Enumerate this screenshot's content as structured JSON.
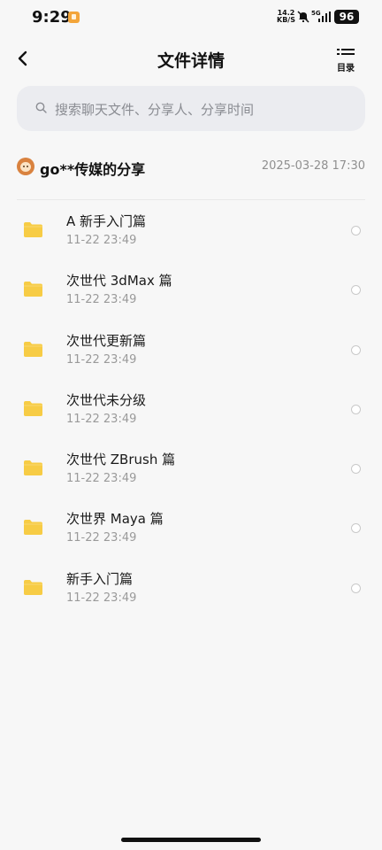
{
  "status_bar": {
    "time": "9:29",
    "net_speed_value": "14.2",
    "net_speed_unit": "KB/S",
    "network_type": "5G",
    "battery": "96"
  },
  "header": {
    "title": "文件详情",
    "toc_label": "目录"
  },
  "search": {
    "placeholder": "搜索聊天文件、分享人、分享时间"
  },
  "share": {
    "sharer": "go**传媒的分享",
    "time": "2025-03-28  17:30"
  },
  "files": [
    {
      "name": "A 新手入门篇",
      "date": "11-22  23:49"
    },
    {
      "name": "次世代 3dMax 篇",
      "date": "11-22  23:49"
    },
    {
      "name": "次世代更新篇",
      "date": "11-22  23:49"
    },
    {
      "name": "次世代未分级",
      "date": "11-22  23:49"
    },
    {
      "name": "次世代 ZBrush 篇",
      "date": "11-22  23:49"
    },
    {
      "name": "次世界 Maya 篇",
      "date": "11-22  23:49"
    },
    {
      "name": "新手入门篇",
      "date": "11-22  23:49"
    }
  ],
  "colors": {
    "folder": "#f7cc45",
    "search_bg": "#ebecf0",
    "page_bg": "#f7f7f7"
  },
  "icons": [
    "back-arrow-icon",
    "toc-list-icon",
    "search-icon",
    "folder-icon",
    "mute-icon",
    "signal-icon"
  ]
}
